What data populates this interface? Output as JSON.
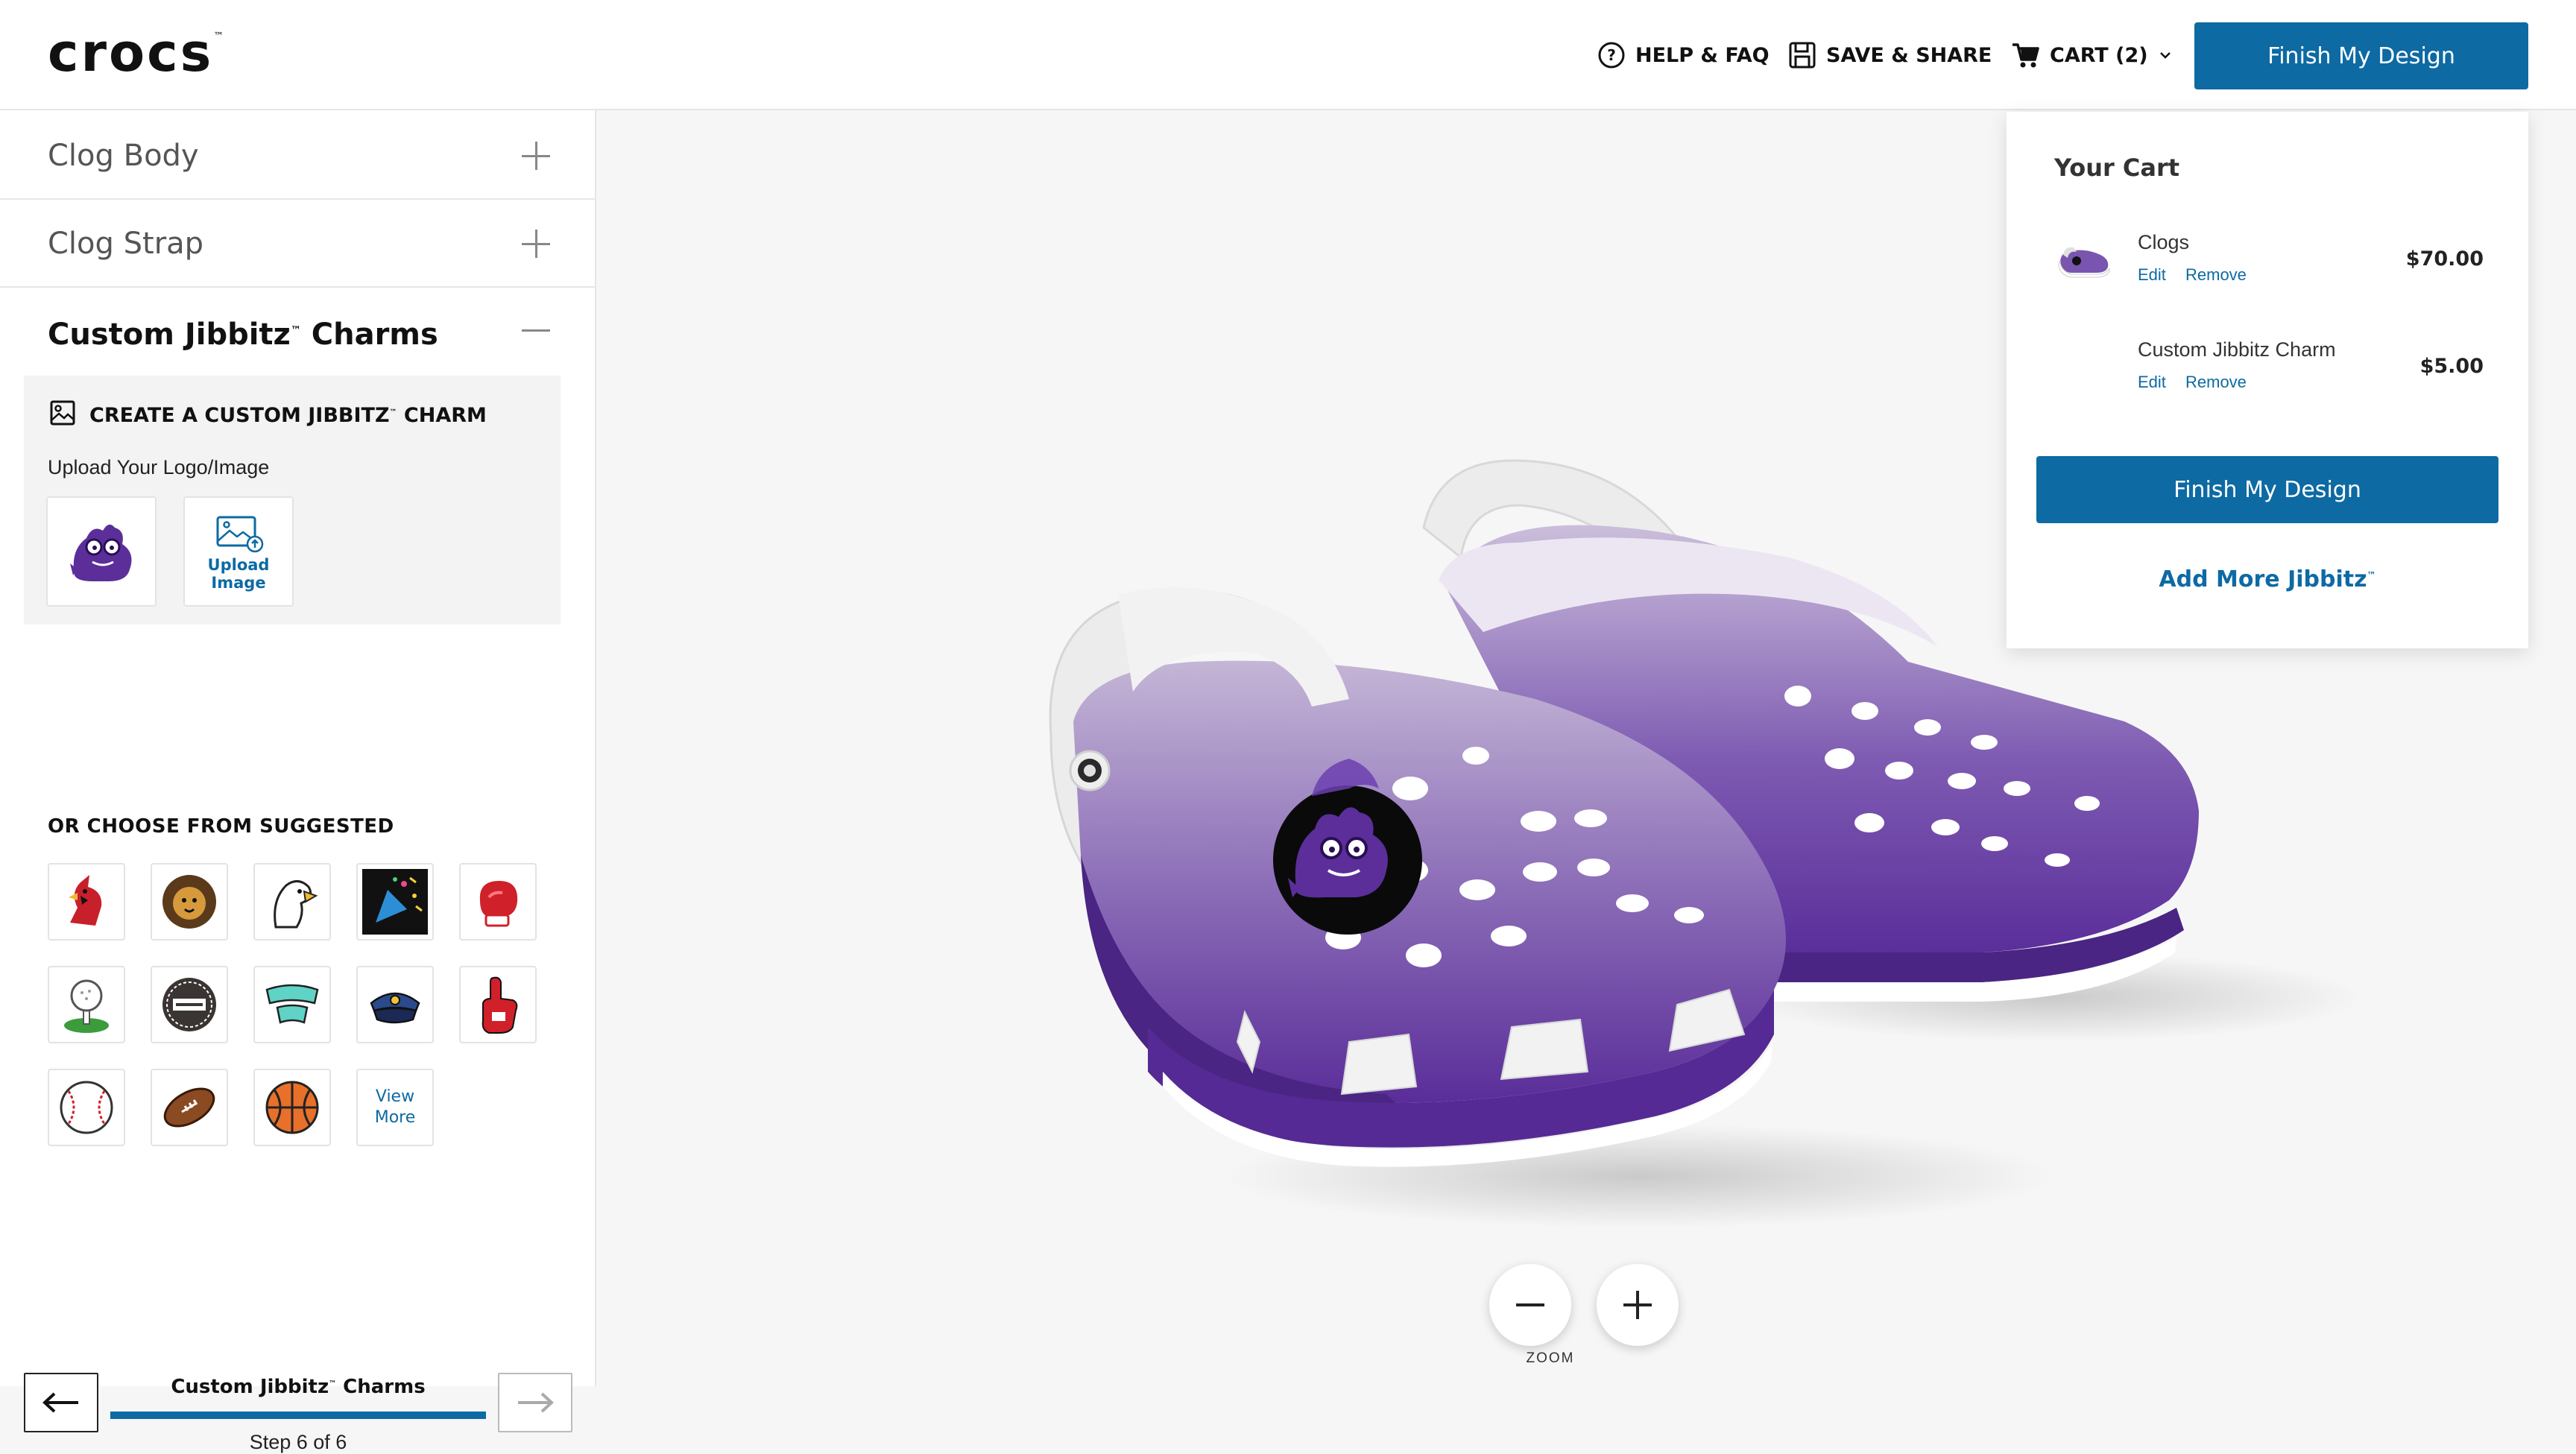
{
  "header": {
    "logo_text": "crocs",
    "logo_tm": "™",
    "help_label": "HELP & FAQ",
    "save_label": "SAVE & SHARE",
    "cart_label": "CART (2)",
    "finish_label": "Finish My Design"
  },
  "sidebar": {
    "sections": [
      {
        "title": "Clog Body",
        "state": "collapsed"
      },
      {
        "title": "Clog Strap",
        "state": "collapsed"
      },
      {
        "title": "Custom Jibbitz",
        "title_tm": "™",
        "title_suffix": " Charms",
        "state": "expanded"
      }
    ],
    "create": {
      "title": "CREATE A CUSTOM JIBBITZ",
      "title_tm": "™",
      "title_suffix": " CHARM",
      "upload_label": "Upload Your Logo/Image",
      "upload_line1": "Upload",
      "upload_line2": "Image"
    },
    "suggested_title": "OR CHOOSE FROM SUGGESTED",
    "suggested_icons": [
      "cardinal-icon",
      "lion-icon",
      "eagle-icon",
      "party-popper-icon",
      "boxing-glove-icon",
      "golf-ball-icon",
      "wedding-badge-icon",
      "thank-you-icon",
      "police-hat-icon",
      "foam-finger-icon",
      "baseball-icon",
      "football-icon",
      "basketball-icon"
    ],
    "view_more_line1": "View",
    "view_more_line2": "More",
    "stepper": {
      "name": "Custom Jibbitz",
      "name_tm": "™",
      "name_suffix": " Charms",
      "count": "Step 6 of 6",
      "progress": 1.0
    }
  },
  "viewer": {
    "zoom_label": "ZOOM",
    "clog_colors": {
      "top": "#b8a9cc",
      "bottom": "#5b2e9a",
      "strap": "#eeeeee",
      "sole": "#ffffff"
    }
  },
  "cart": {
    "title": "Your Cart",
    "items": [
      {
        "name": "Clogs",
        "price": "$70.00",
        "edit": "Edit",
        "remove": "Remove"
      },
      {
        "name": "Custom Jibbitz Charm",
        "price": "$5.00",
        "edit": "Edit",
        "remove": "Remove"
      }
    ],
    "finish_label": "Finish My Design",
    "add_more": "Add More Jibbitz",
    "add_more_tm": "™"
  },
  "colors": {
    "accent": "#0d6aa3",
    "purple": "#5b2e9a"
  }
}
